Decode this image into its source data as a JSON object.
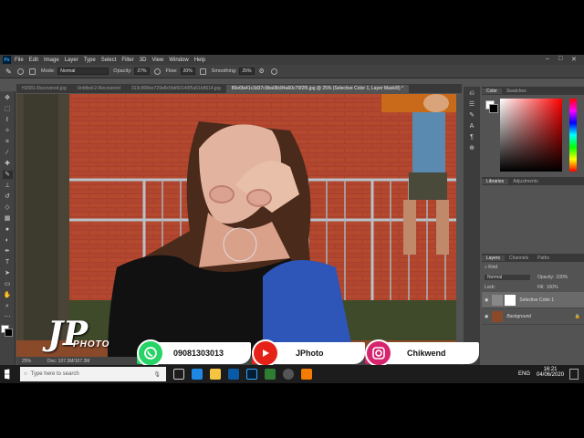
{
  "menubar": {
    "items": [
      "File",
      "Edit",
      "Image",
      "Layer",
      "Type",
      "Select",
      "Filter",
      "3D",
      "View",
      "Window",
      "Help"
    ]
  },
  "options": {
    "mode_label": "Mode:",
    "mode_value": "Normal",
    "opacity_label": "Opacity:",
    "opacity_value": "27%",
    "flow_label": "Flow:",
    "flow_value": "20%",
    "smoothing_label": "Smoothing:",
    "smoothing_value": "25%"
  },
  "tabs": [
    "H2081-Recovered.jpg",
    "Untitled-2-Recovered",
    "313c908ee729e8c5bb50140f5a51b8614.jpg",
    "89e6fa41c3d37c9ba08c84a60c76f2f5.jpg @ 25% (Selective Color 1, Layer Mask/8) *"
  ],
  "status": {
    "zoom": "25%",
    "doc": "Doc: 107.3M/107.3M"
  },
  "panels": {
    "color_tabs": [
      "Color",
      "Swatches"
    ],
    "libraries_tabs": [
      "Libraries",
      "Adjustments"
    ],
    "layers_tabs": [
      "Layers",
      "Channels",
      "Paths"
    ],
    "kind_label": "Kind",
    "blend_mode": "Normal",
    "opacity_label": "Opacity:",
    "opacity_value": "100%",
    "lock_label": "Lock:",
    "fill_label": "Fill:",
    "fill_value": "100%",
    "layers": [
      "Selective Color 1",
      "Background"
    ]
  },
  "overlay": {
    "logo_main": "JP",
    "logo_sub": "PHOTO",
    "whatsapp": "09081303013",
    "youtube": "JPhoto",
    "instagram": "Chikwend"
  },
  "taskbar": {
    "search_placeholder": "Type here to search",
    "lang": "ENG",
    "time": "16:21",
    "date": "04/06/2020"
  },
  "colors": {
    "whatsapp": "#25d366",
    "youtube": "#e62117",
    "instagram": "#d6246e",
    "ps_bg": "#535353"
  }
}
